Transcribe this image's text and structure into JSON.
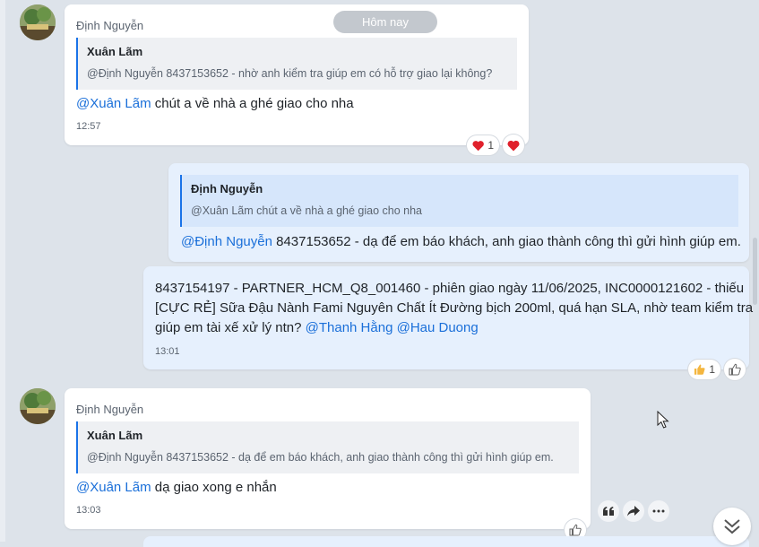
{
  "date_separator": "Hôm nay",
  "messages": [
    {
      "sender": "Định Nguyễn",
      "quote": {
        "name": "Xuân Lãm",
        "text": "@Định Nguyễn 8437153652 - nhờ anh kiểm tra giúp em có hỗ trợ giao lại không?"
      },
      "mention": "@Xuân Lãm",
      "text": " chút a về nhà a ghé giao cho nha",
      "time": "12:57",
      "reactions": {
        "heart_count": "1"
      }
    },
    {
      "quote": {
        "name": "Định Nguyễn",
        "text": "@Xuân Lãm chút a về nhà a ghé giao cho nha"
      },
      "mention": "@Định Nguyễn",
      "text": " 8437153652 - dạ để em báo khách, anh giao thành công thì gửi hình giúp em."
    },
    {
      "lines": [
        "8437154197 - PARTNER_HCM_Q8_001460 - phiên giao ngày 11/06/2025, INC0000121602 - thiếu",
        "[CỰC RẺ] Sữa Đậu Nành Fami Nguyên Chất Ít Đường bịch 200ml, quá hạn SLA, nhờ team kiểm tra",
        "giúp em tài xế xử lý ntn? "
      ],
      "mention_1": "@Thanh Hằng",
      "mention_2": "@Hau Duong",
      "time": "13:01",
      "reactions": {
        "thumb_count": "1"
      }
    },
    {
      "sender": "Định Nguyễn",
      "quote": {
        "name": "Xuân Lãm",
        "text": "@Định Nguyễn 8437153652 - dạ để em báo khách, anh giao thành công thì gửi hình giúp em."
      },
      "mention": "@Xuân Lãm",
      "text": " dạ giao xong e nhắn",
      "time": "13:03"
    }
  ],
  "icons": {
    "heart": "heart-icon",
    "thumbs_up": "thumbs-up-icon",
    "quote": "quote-icon",
    "forward": "forward-icon",
    "more": "more-icon",
    "scroll_down": "chevron-double-down-icon"
  },
  "colors": {
    "accent": "#1a73e8",
    "mention": "#1a6fd9",
    "outgoing_bubble": "#e6f0fd",
    "incoming_bubble": "#ffffff",
    "background": "#dde3ea"
  }
}
